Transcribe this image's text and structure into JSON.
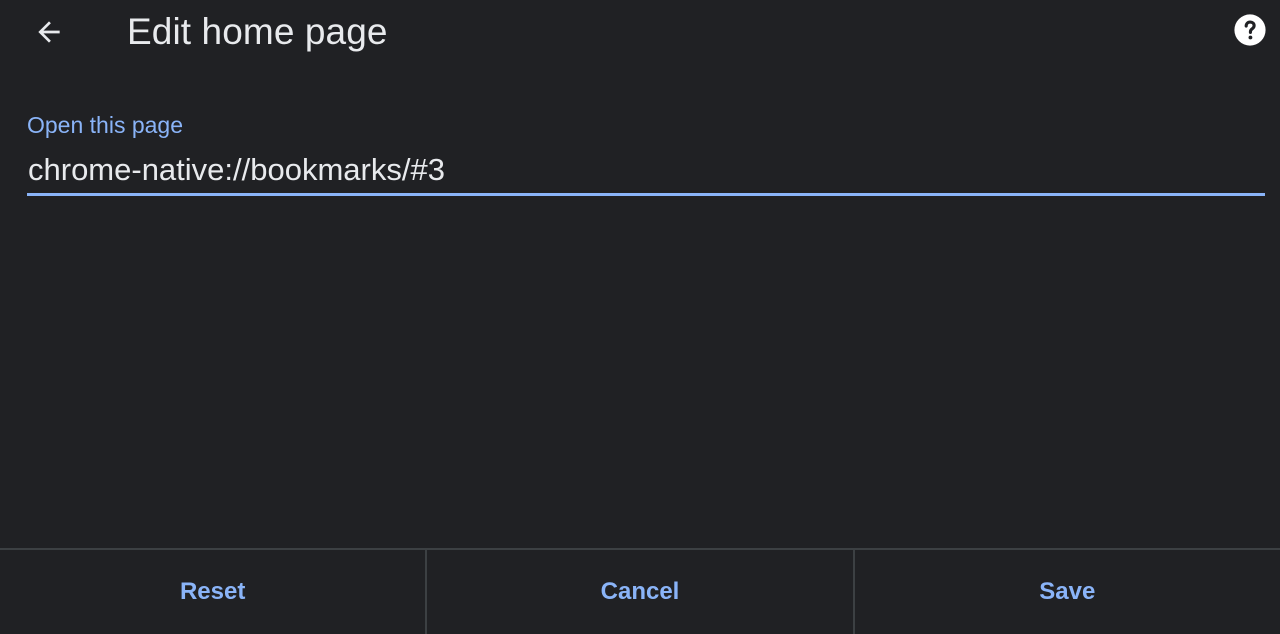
{
  "header": {
    "title": "Edit home page",
    "back_icon": "arrow-back-icon",
    "help_icon": "help-icon"
  },
  "form": {
    "label": "Open this page",
    "value": "chrome-native://bookmarks/#3"
  },
  "buttons": {
    "reset": "Reset",
    "cancel": "Cancel",
    "save": "Save"
  },
  "colors": {
    "background": "#202124",
    "accent": "#8ab4f8",
    "text": "#e8eaed",
    "divider": "#3c4043"
  }
}
